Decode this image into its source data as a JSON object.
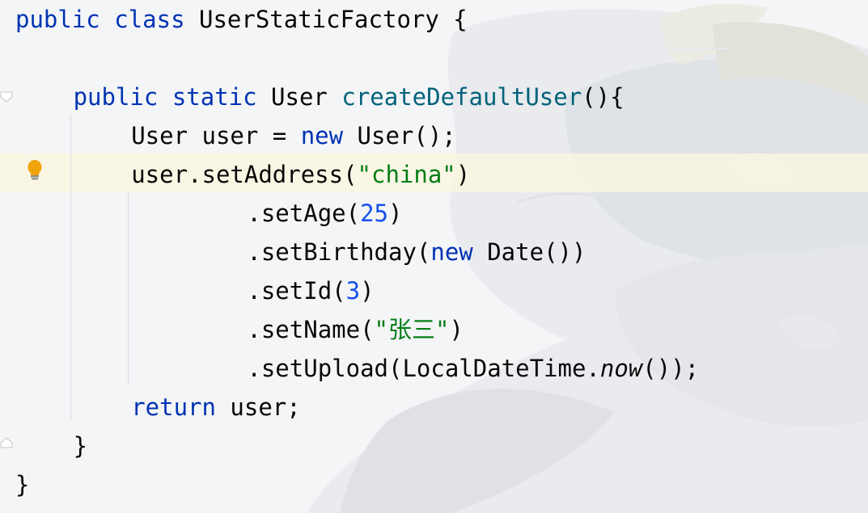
{
  "editor": {
    "language": "java",
    "lines": [
      {
        "indent": 0,
        "tokens": [
          {
            "t": "public",
            "c": "kw"
          },
          {
            "t": " "
          },
          {
            "t": "class",
            "c": "kw"
          },
          {
            "t": " UserStaticFactory {"
          }
        ]
      },
      {
        "indent": 0,
        "tokens": []
      },
      {
        "indent": 4,
        "tokens": [
          {
            "t": "public",
            "c": "kw"
          },
          {
            "t": " "
          },
          {
            "t": "static",
            "c": "kw"
          },
          {
            "t": " User "
          },
          {
            "t": "createDefaultUser",
            "c": "fn"
          },
          {
            "t": "(){"
          }
        ]
      },
      {
        "indent": 8,
        "tokens": [
          {
            "t": "User user = "
          },
          {
            "t": "new",
            "c": "kw"
          },
          {
            "t": " User();"
          }
        ]
      },
      {
        "indent": 8,
        "tokens": [
          {
            "t": "user.setAddress("
          },
          {
            "t": "\"china\"",
            "c": "str"
          },
          {
            "t": ")"
          }
        ]
      },
      {
        "indent": 16,
        "tokens": [
          {
            "t": ".setAge("
          },
          {
            "t": "25",
            "c": "num"
          },
          {
            "t": ")"
          }
        ]
      },
      {
        "indent": 16,
        "tokens": [
          {
            "t": ".setBirthday("
          },
          {
            "t": "new",
            "c": "kw"
          },
          {
            "t": " Date())"
          }
        ]
      },
      {
        "indent": 16,
        "tokens": [
          {
            "t": ".setId("
          },
          {
            "t": "3",
            "c": "num"
          },
          {
            "t": ")"
          }
        ]
      },
      {
        "indent": 16,
        "tokens": [
          {
            "t": ".setName("
          },
          {
            "t": "\"张三\"",
            "c": "str"
          },
          {
            "t": ")"
          }
        ]
      },
      {
        "indent": 16,
        "tokens": [
          {
            "t": ".setUpload(LocalDateTime."
          },
          {
            "t": "now",
            "c": "it"
          },
          {
            "t": "());"
          }
        ]
      },
      {
        "indent": 8,
        "tokens": [
          {
            "t": "return",
            "c": "kw"
          },
          {
            "t": " user;"
          }
        ]
      },
      {
        "indent": 4,
        "tokens": [
          {
            "t": "}"
          }
        ]
      },
      {
        "indent": 0,
        "tokens": [
          {
            "t": "}"
          }
        ]
      }
    ],
    "highlighted_line": 5,
    "gutter_icons": [
      {
        "line": 5,
        "icon": "lightbulb-icon",
        "color": "#f0a30a"
      }
    ],
    "colors": {
      "keyword": "#0033b3",
      "method_declaration": "#00627a",
      "string": "#067d17",
      "number": "#1750eb",
      "text": "#080808",
      "caret_row": "#faf6de",
      "background": "#f4f5f7"
    }
  }
}
